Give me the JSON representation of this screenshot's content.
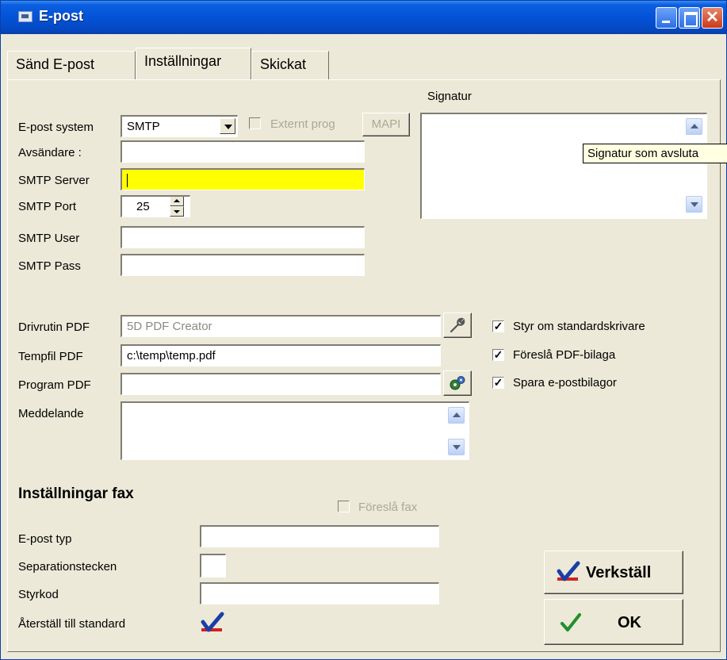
{
  "window": {
    "title": "E-post"
  },
  "tabs": [
    {
      "label": "Sänd E-post",
      "active": false
    },
    {
      "label": "Inställningar",
      "active": true
    },
    {
      "label": "Skickat",
      "active": false
    }
  ],
  "email": {
    "system_label": "E-post system",
    "system_value": "SMTP",
    "external_prog_label": "Externt prog",
    "mapi_label": "MAPI",
    "sender_label": "Avsändare :",
    "sender_value": "",
    "smtp_server_label": "SMTP Server",
    "smtp_server_value": "",
    "smtp_port_label": "SMTP Port",
    "smtp_port_value": "25",
    "smtp_user_label": "SMTP User",
    "smtp_user_value": "",
    "smtp_pass_label": "SMTP Pass",
    "smtp_pass_value": ""
  },
  "signature": {
    "label": "Signatur",
    "value": "",
    "tooltip": "Signatur som avsluta"
  },
  "pdf": {
    "driver_label": "Drivrutin PDF",
    "driver_value": "5D PDF Creator",
    "tempfile_label": "Tempfil PDF",
    "tempfile_value": "c:\\temp\\temp.pdf",
    "program_label": "Program PDF",
    "program_value": "",
    "message_label": "Meddelande",
    "message_value": ""
  },
  "options": [
    {
      "label": "Styr om standardskrivare",
      "checked": true
    },
    {
      "label": "Föreslå PDF-bilaga",
      "checked": true
    },
    {
      "label": "Spara e-postbilagor",
      "checked": true
    }
  ],
  "fax": {
    "heading": "Inställningar fax",
    "suggest_fax_label": "Föreslå fax",
    "email_type_label": "E-post typ",
    "email_type_value": "",
    "separator_label": "Separationstecken",
    "separator_value": "",
    "control_code_label": "Styrkod",
    "control_code_value": "",
    "reset_label": "Återställ till standard"
  },
  "buttons": {
    "apply_label": "Verkställ",
    "ok_label": "OK"
  },
  "colors": {
    "highlight_input": "#ffff00",
    "titlebar": "#0452d6",
    "window_bg": "#ece9d8"
  }
}
